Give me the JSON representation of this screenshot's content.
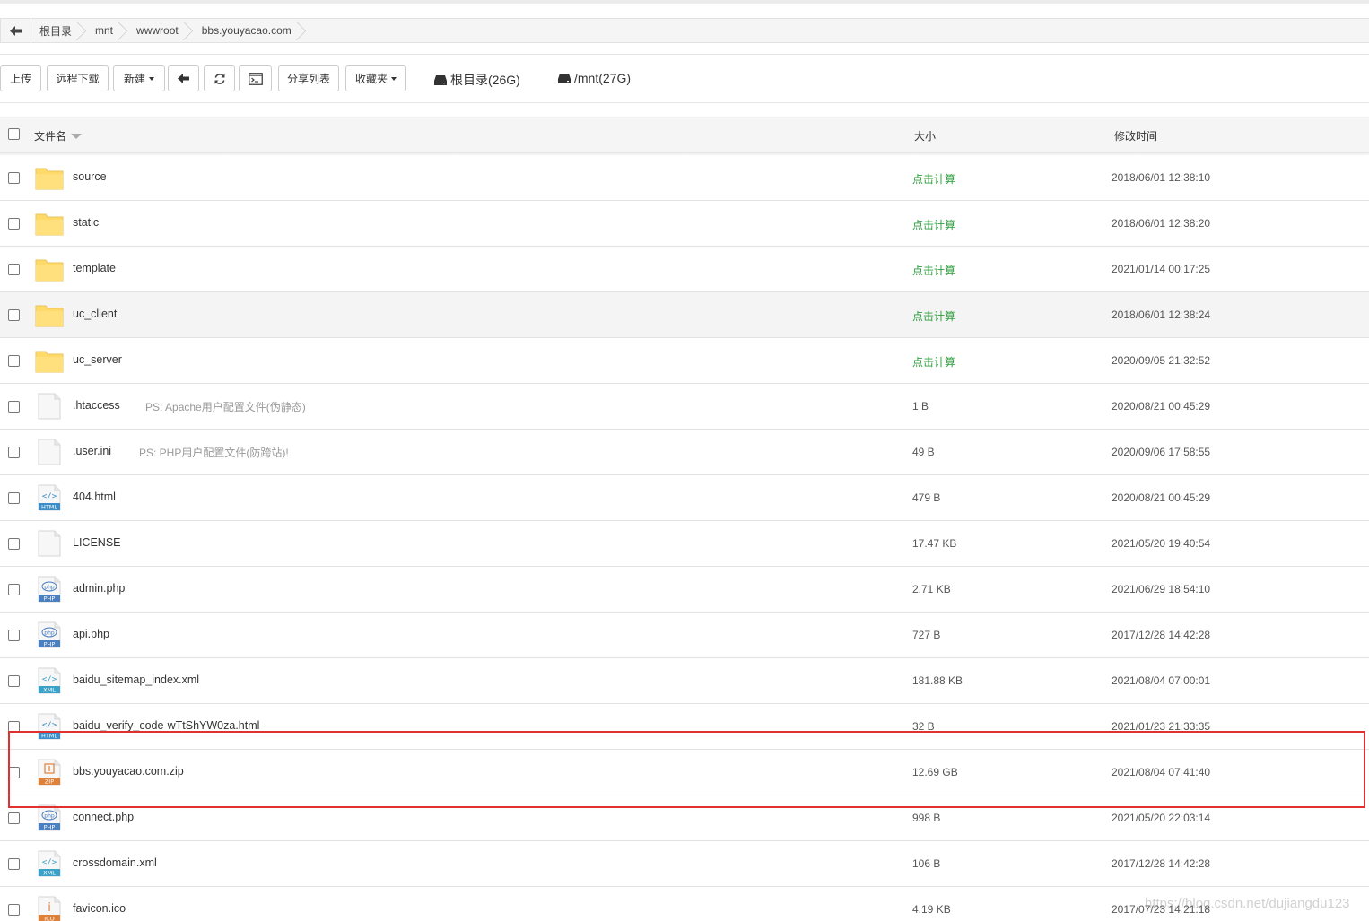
{
  "breadcrumb": {
    "back_icon": "arrow-left-icon",
    "items": [
      "根目录",
      "mnt",
      "wwwroot",
      "bbs.youyacao.com"
    ]
  },
  "toolbar": {
    "upload": "上传",
    "remote_download": "远程下载",
    "new": "新建",
    "back_icon": "arrow-left-icon",
    "refresh_icon": "refresh-icon",
    "terminal_icon": "terminal-icon",
    "share_list": "分享列表",
    "favorites": "收藏夹",
    "disks": [
      "根目录(26G)",
      "/mnt(27G)"
    ]
  },
  "table": {
    "headers": {
      "name": "文件名",
      "size": "大小",
      "mtime": "修改时间"
    },
    "rows": [
      {
        "name": "source",
        "type": "folder",
        "note": "",
        "size": "点击计算",
        "mtime": "2018/06/01 12:38:10"
      },
      {
        "name": "static",
        "type": "folder",
        "note": "",
        "size": "点击计算",
        "mtime": "2018/06/01 12:38:20"
      },
      {
        "name": "template",
        "type": "folder",
        "note": "",
        "size": "点击计算",
        "mtime": "2021/01/14 00:17:25"
      },
      {
        "name": "uc_client",
        "type": "folder",
        "note": "",
        "size": "点击计算",
        "mtime": "2018/06/01 12:38:24"
      },
      {
        "name": "uc_server",
        "type": "folder",
        "note": "",
        "size": "点击计算",
        "mtime": "2020/09/05 21:32:52"
      },
      {
        "name": ".htaccess",
        "type": "blank",
        "note": "PS: Apache用户配置文件(伪静态)",
        "size": "1 B",
        "mtime": "2020/08/21 00:45:29"
      },
      {
        "name": ".user.ini",
        "type": "blank",
        "note": "PS: PHP用户配置文件(防跨站)!",
        "size": "49 B",
        "mtime": "2020/09/06 17:58:55"
      },
      {
        "name": "404.html",
        "type": "html",
        "note": "",
        "size": "479 B",
        "mtime": "2020/08/21 00:45:29"
      },
      {
        "name": "LICENSE",
        "type": "blank",
        "note": "",
        "size": "17.47 KB",
        "mtime": "2021/05/20 19:40:54"
      },
      {
        "name": "admin.php",
        "type": "php",
        "note": "",
        "size": "2.71 KB",
        "mtime": "2021/06/29 18:54:10"
      },
      {
        "name": "api.php",
        "type": "php",
        "note": "",
        "size": "727 B",
        "mtime": "2017/12/28 14:42:28"
      },
      {
        "name": "baidu_sitemap_index.xml",
        "type": "xml",
        "note": "",
        "size": "181.88 KB",
        "mtime": "2021/08/04 07:00:01"
      },
      {
        "name": "baidu_verify_code-wTtShYW0za.html",
        "type": "html",
        "note": "",
        "size": "32 B",
        "mtime": "2021/01/23 21:33:35"
      },
      {
        "name": "bbs.youyacao.com.zip",
        "type": "zip",
        "note": "",
        "size": "12.69 GB",
        "mtime": "2021/08/04 07:41:40"
      },
      {
        "name": "connect.php",
        "type": "php",
        "note": "",
        "size": "998 B",
        "mtime": "2021/05/20 22:03:14"
      },
      {
        "name": "crossdomain.xml",
        "type": "xml",
        "note": "",
        "size": "106 B",
        "mtime": "2017/12/28 14:42:28"
      },
      {
        "name": "favicon.ico",
        "type": "ico",
        "note": "",
        "size": "4.19 KB",
        "mtime": "2017/07/23 14:21:18"
      }
    ]
  },
  "icon_labels": {
    "html": "HTML",
    "php": "PHP",
    "xml": "XML",
    "zip": "ZIP",
    "ico": "ICO"
  },
  "watermark": "https://blog.csdn.net/dujiangdu123",
  "colors": {
    "folder": "#ffd96a",
    "calc_green": "#2e9e3e",
    "highlight_box": "#e03030"
  }
}
